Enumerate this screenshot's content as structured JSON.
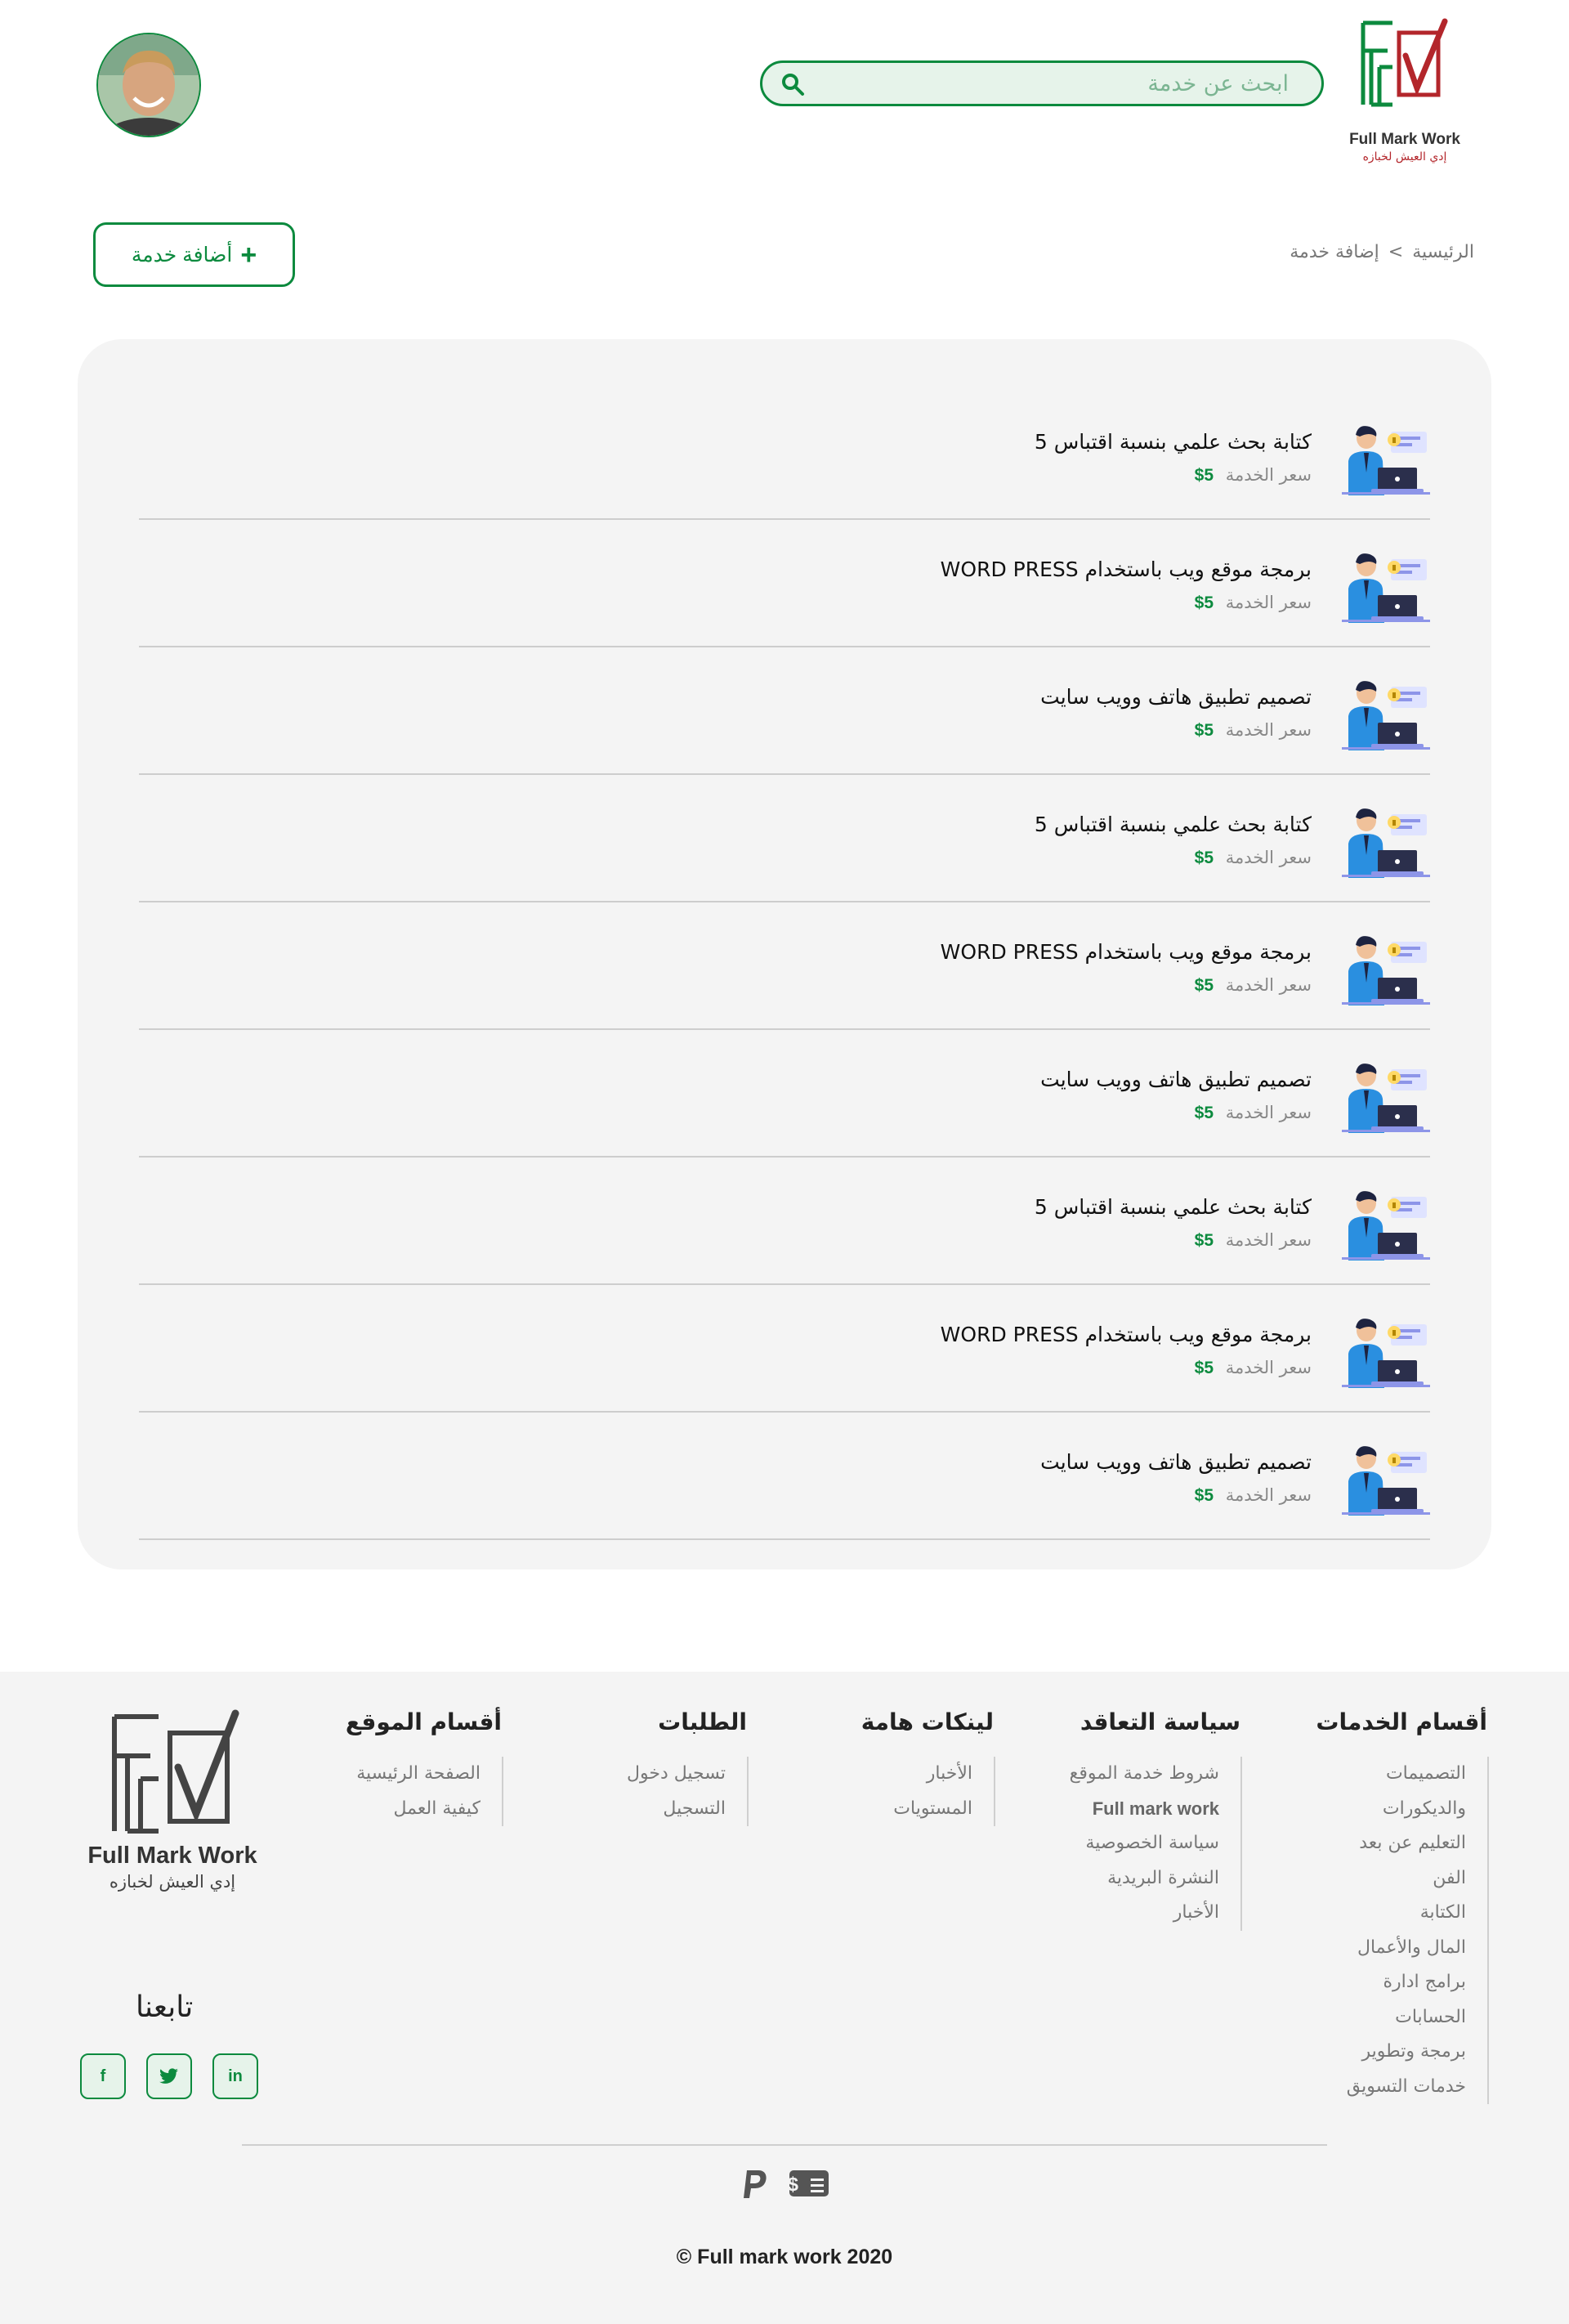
{
  "header": {
    "logo_text_en": "Full Mark Work",
    "logo_text_ar": "إدي العيش لخبازه",
    "search_placeholder": "ابحث عن خدمة",
    "search_icon": "search-icon",
    "avatar_alt": "avatar"
  },
  "breadcrumb": {
    "home": "الرئيسية",
    "separator": ">",
    "current": "إضافة خدمة"
  },
  "add_button": {
    "label": "أضافة خدمة",
    "icon": "plus-icon"
  },
  "services": [
    {
      "title": "كتابة بحث علمي بنسبة اقتباس 5",
      "price_label": "سعر الخدمة",
      "price": "5$"
    },
    {
      "title": "برمجة موقع ويب باستخدام WORD PRESS",
      "price_label": "سعر الخدمة",
      "price": "5$"
    },
    {
      "title": "تصميم تطبيق هاتف وويب سايت",
      "price_label": "سعر الخدمة",
      "price": "5$"
    },
    {
      "title": "كتابة بحث علمي بنسبة اقتباس 5",
      "price_label": "سعر الخدمة",
      "price": "5$"
    },
    {
      "title": "برمجة موقع ويب باستخدام WORD PRESS",
      "price_label": "سعر الخدمة",
      "price": "5$"
    },
    {
      "title": "تصميم تطبيق هاتف وويب سايت",
      "price_label": "سعر الخدمة",
      "price": "5$"
    },
    {
      "title": "كتابة بحث علمي بنسبة اقتباس 5",
      "price_label": "سعر الخدمة",
      "price": "5$"
    },
    {
      "title": "برمجة موقع ويب باستخدام WORD PRESS",
      "price_label": "سعر الخدمة",
      "price": "5$"
    },
    {
      "title": "تصميم تطبيق هاتف وويب سايت",
      "price_label": "سعر الخدمة",
      "price": "5$"
    }
  ],
  "footer": {
    "columns": [
      {
        "title": "أقسام الخدمات",
        "items": [
          "التصميمات",
          "والديكورات",
          "التعليم عن بعد",
          "الفن",
          "الكتابة",
          "المال والأعمال",
          "برامج ادارة",
          "الحسابات",
          "برمجة وتطوير",
          "خدمات التسويق"
        ]
      },
      {
        "title": "سياسة التعاقد",
        "items": [
          "شروط خدمة الموقع",
          "Full mark work",
          "سياسة الخصوصية",
          "النشرة البريدية",
          "الأخبار"
        ]
      },
      {
        "title": "لينكات هامة",
        "items": [
          "الأخبار",
          "المستويات"
        ]
      },
      {
        "title": "الطلبات",
        "items": [
          "تسجيل دخول",
          "التسجيل"
        ]
      },
      {
        "title": "أقسام الموقع",
        "items": [
          "الصفحة الرئيسية",
          "كيفية العمل"
        ]
      }
    ],
    "logo_text_en": "Full Mark Work",
    "logo_text_ar": "إدي العيش لخبازه",
    "follow_label": "تابعنا",
    "social": [
      {
        "name": "facebook-icon",
        "glyph": "f"
      },
      {
        "name": "twitter-icon",
        "glyph": "t"
      },
      {
        "name": "linkedin-icon",
        "glyph": "in"
      }
    ],
    "payment_icons": [
      "paypal-icon",
      "cash-icon"
    ],
    "copyright": "Full mark work 2020 ©"
  },
  "colors": {
    "brand_green": "#0c8a3e",
    "brand_red": "#b3262b",
    "panel_bg": "#f4f4f4"
  }
}
